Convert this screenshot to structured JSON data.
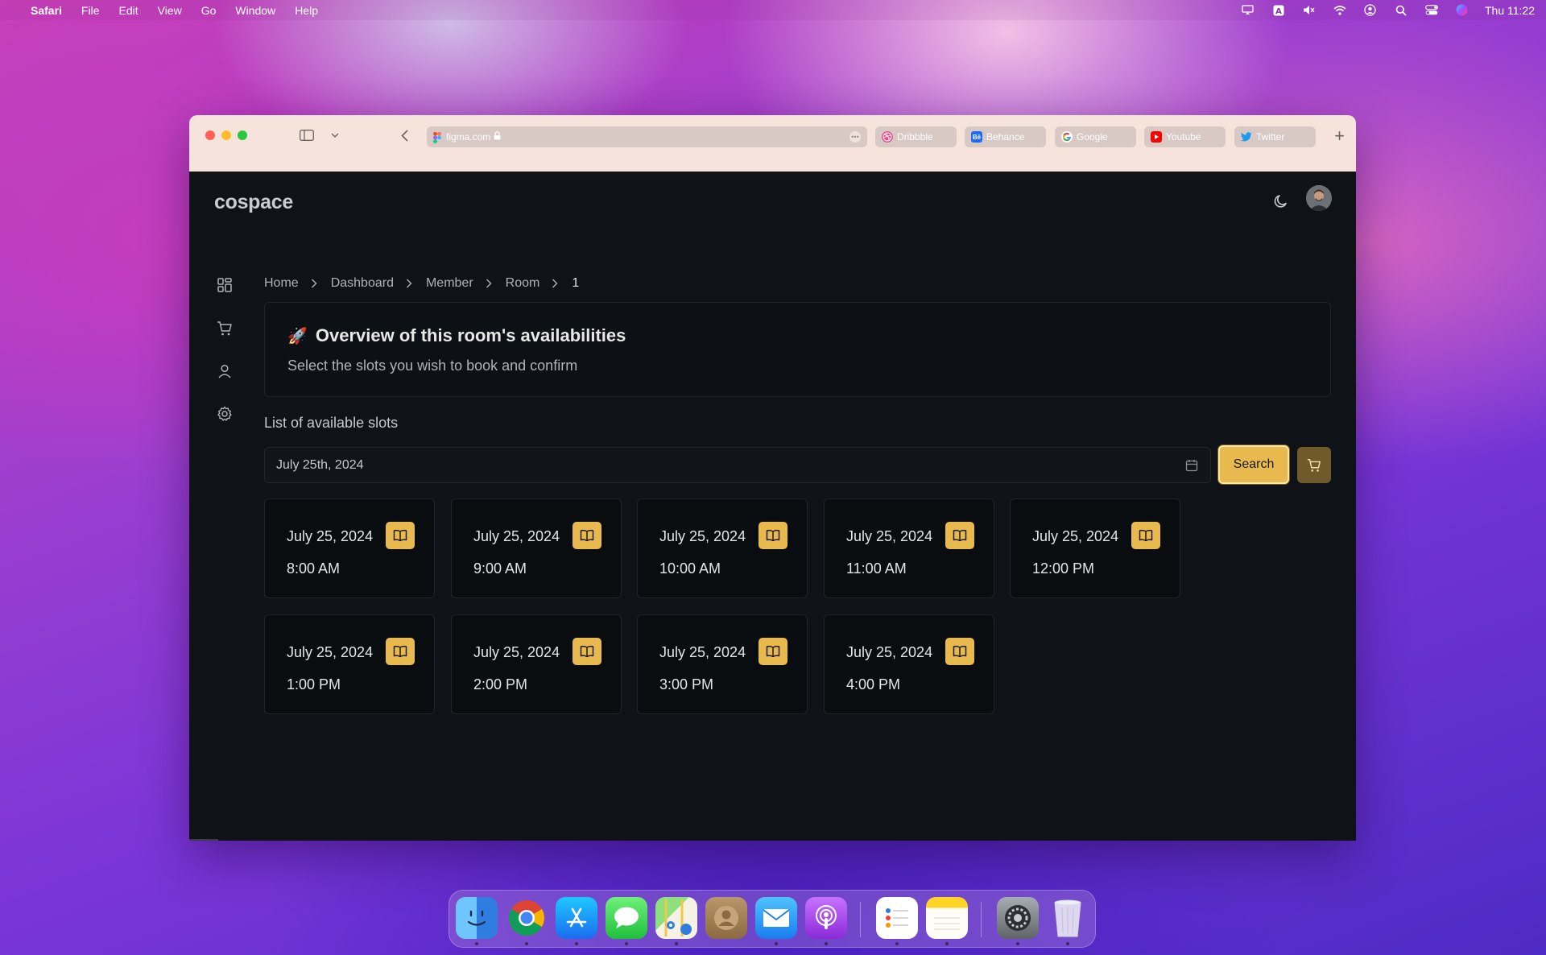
{
  "menubar": {
    "app_name": "Safari",
    "menus": [
      "File",
      "Edit",
      "View",
      "Go",
      "Window",
      "Help"
    ],
    "clock": "Thu 11:22"
  },
  "browser": {
    "url": "figma.com",
    "tabs": [
      {
        "label": "Dribbble",
        "icon": "dribbble-icon",
        "color": "#ea4c89"
      },
      {
        "label": "Behance",
        "icon": "behance-icon",
        "color": "#1769ff"
      },
      {
        "label": "Google",
        "icon": "google-icon",
        "color": "#4285f4"
      },
      {
        "label": "Youtube",
        "icon": "youtube-icon",
        "color": "#ff0000"
      },
      {
        "label": "Twitter",
        "icon": "twitter-icon",
        "color": "#1d9bf0"
      }
    ]
  },
  "app": {
    "logo": "cospace",
    "accent_color": "#e7b94f",
    "breadcrumb": [
      "Home",
      "Dashboard",
      "Member",
      "Room",
      "1"
    ],
    "overview": {
      "emoji": "🚀",
      "title": "Overview of this room's availabilities",
      "subtitle": "Select the slots you wish to book and confirm"
    },
    "list_title": "List of available slots",
    "date_value": "July 25th, 2024",
    "search_label": "Search",
    "slots": [
      {
        "date": "July 25, 2024",
        "time": "8:00 AM"
      },
      {
        "date": "July 25, 2024",
        "time": "9:00 AM"
      },
      {
        "date": "July 25, 2024",
        "time": "10:00 AM"
      },
      {
        "date": "July 25, 2024",
        "time": "11:00 AM"
      },
      {
        "date": "July 25, 2024",
        "time": "12:00 PM"
      },
      {
        "date": "July 25, 2024",
        "time": "1:00 PM"
      },
      {
        "date": "July 25, 2024",
        "time": "2:00 PM"
      },
      {
        "date": "July 25, 2024",
        "time": "3:00 PM"
      },
      {
        "date": "July 25, 2024",
        "time": "4:00 PM"
      }
    ]
  },
  "dock": {
    "apps": [
      "Finder",
      "Chrome",
      "App Store",
      "Messages",
      "Maps",
      "Contacts",
      "Mail",
      "Podcasts",
      "Reminders",
      "Notes",
      "System Settings",
      "Trash"
    ]
  }
}
